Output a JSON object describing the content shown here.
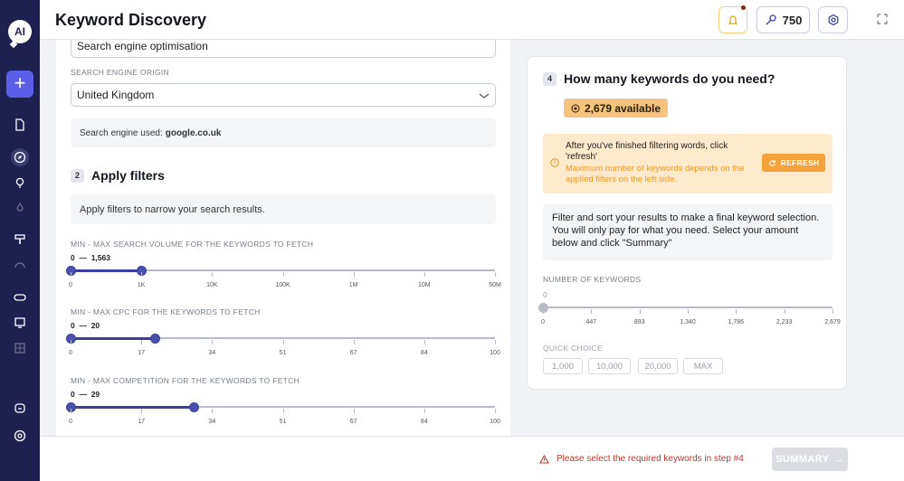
{
  "app": {
    "logo_text": "AI",
    "title": "Keyword Discovery",
    "credits": "750"
  },
  "left": {
    "topic_value": "Search engine optimisation",
    "origin_label": "SEARCH ENGINE ORIGIN",
    "origin_value": "United Kingdom",
    "engine_used_prefix": "Search engine used: ",
    "engine_used_value": "google.co.uk",
    "step2_num": "2",
    "step2_title": "Apply filters",
    "step2_desc": "Apply filters to narrow your search results.",
    "sliders": [
      {
        "label": "MIN - MAX SEARCH VOLUME FOR THE KEYWORDS TO FETCH",
        "min": "0",
        "dash": "—",
        "max": "1,563",
        "ticks": [
          "0",
          "1K",
          "10K",
          "100K",
          "1M",
          "10M",
          "50M"
        ],
        "min_fraction": 0,
        "max_fraction": 0.1667
      },
      {
        "label": "MIN - MAX CPC FOR THE KEYWORDS TO FETCH",
        "min": "0",
        "dash": "—",
        "max": "20",
        "ticks": [
          "0",
          "17",
          "34",
          "51",
          "67",
          "84",
          "100"
        ],
        "min_fraction": 0,
        "max_fraction": 0.2
      },
      {
        "label": "MIN - MAX COMPETITION FOR THE KEYWORDS TO FETCH",
        "min": "0",
        "dash": "—",
        "max": "29",
        "ticks": [
          "0",
          "17",
          "34",
          "51",
          "67",
          "84",
          "100"
        ],
        "min_fraction": 0,
        "max_fraction": 0.29
      }
    ]
  },
  "right": {
    "step4_num": "4",
    "step4_title": "How many keywords do you need?",
    "available": "2,679 available",
    "warn_line1": "After you've finished filtering words, click 'refresh'",
    "warn_line2": "Maximum number of keywords depends on the applied filters on the left side.",
    "refresh_label": "REFRESH",
    "filter_text": "Filter and sort your results to make a final keyword selection. You will only pay for what you need. Select your amount below and click \"Summary\"",
    "num_label": "NUMBER OF KEYWORDS",
    "num_value": "0",
    "num_fraction": 0,
    "num_ticks": [
      "0",
      "447",
      "893",
      "1,340",
      "1,786",
      "2,233",
      "2,679"
    ],
    "quick_label": "QUICK CHOICE",
    "quick": [
      "1,000",
      "10,000",
      "20,000",
      "MAX"
    ]
  },
  "bottom": {
    "warning": "Please select the required keywords in step #4",
    "summary_label": "SUMMARY"
  },
  "colors": {
    "sidebar": "#1e2150",
    "accent": "#3b3f9e",
    "badge": "#f7c47d",
    "warning": "#f6a23b",
    "error": "#c0392b"
  }
}
